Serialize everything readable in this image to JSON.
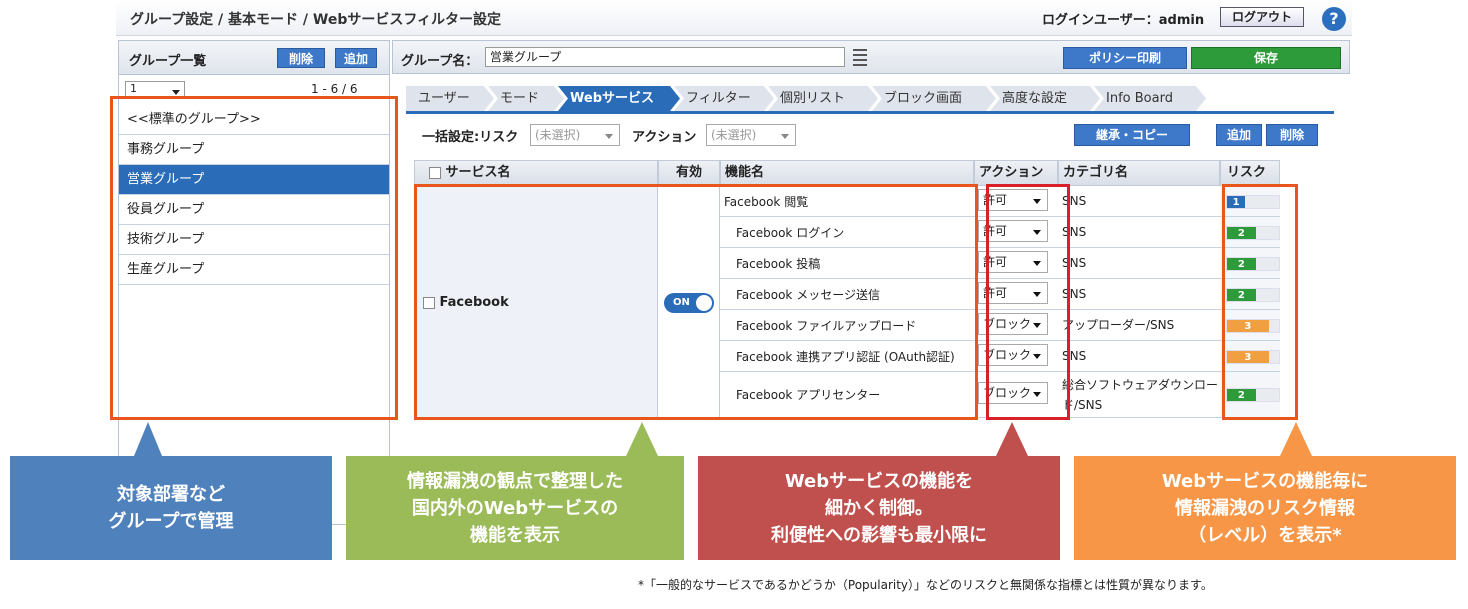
{
  "header": {
    "breadcrumb": "グループ設定 / 基本モード / Webサービスフィルター設定",
    "login_label": "ログインユーザー：admin",
    "logout": "ログアウト",
    "help": "?"
  },
  "group_panel": {
    "title": "グループ一覧",
    "delete": "削除",
    "add": "追加",
    "page": "1",
    "count": "1 - 6 / 6",
    "items": [
      "<<標準のグループ>>",
      "事務グループ",
      "営業グループ",
      "役員グループ",
      "技術グループ",
      "生産グループ"
    ],
    "selected": "営業グループ"
  },
  "main": {
    "group_name_label": "グループ名：",
    "group_name_value": "営業グループ",
    "print_button": "ポリシー印刷",
    "save_button": "保存",
    "tabs": [
      "ユーザー",
      "モード",
      "Webサービス",
      "フィルター",
      "個別リスト",
      "ブロック画面",
      "高度な設定",
      "Info Board"
    ],
    "active_tab": "Webサービス",
    "bulk_label": "一括設定:リスク",
    "bulk_risk_placeholder": "(未選択)",
    "action_label": "アクション",
    "action_placeholder": "(未選択)",
    "inherit_button": "継承・コピー",
    "add_button": "追加",
    "delete_button": "削除",
    "columns": {
      "service": "サービス名",
      "enabled": "有効",
      "function": "機能名",
      "action": "アクション",
      "category": "カテゴリ名",
      "risk": "リスク"
    },
    "service_name": "Facebook",
    "toggle": "ON",
    "rows": [
      {
        "function": "Facebook 閲覧",
        "action": "許可",
        "category": "SNS",
        "risk": "1"
      },
      {
        "function": "Facebook ログイン",
        "action": "許可",
        "category": "SNS",
        "risk": "2"
      },
      {
        "function": "Facebook 投稿",
        "action": "許可",
        "category": "SNS",
        "risk": "2"
      },
      {
        "function": "Facebook メッセージ送信",
        "action": "許可",
        "category": "SNS",
        "risk": "2"
      },
      {
        "function": "Facebook ファイルアップロード",
        "action": "ブロック",
        "category": "アップローダー/SNS",
        "risk": "3"
      },
      {
        "function": "Facebook 連携アプリ認証 (OAuth認証)",
        "action": "ブロック",
        "category": "SNS",
        "risk": "3"
      },
      {
        "function": "Facebook アプリセンター",
        "action": "ブロック",
        "category": "総合ソフトウェアダウンロード/SNS",
        "risk": "2"
      }
    ]
  },
  "callouts": {
    "blue": [
      "対象部署など",
      "グループで管理"
    ],
    "green": [
      "情報漏洩の観点で整理した",
      "国内外のWebサービスの",
      "機能を表示"
    ],
    "red": [
      "Webサービスの機能を",
      "細かく制御。",
      "利便性への影響も最小限に"
    ],
    "orange": [
      "Webサービスの機能毎に",
      "情報漏洩のリスク情報",
      "（レベル）を表示*"
    ]
  },
  "footnote": "*「一般的なサービスであるかどうか（Popularity）」などのリスクと無関係な指標とは性質が異なります。",
  "colors": {
    "blue": "#4f81bd",
    "green": "#9bbb59",
    "red": "#c0504d",
    "orange": "#f79646",
    "frame": "#e8561c",
    "risk1": "#2b6cb8",
    "risk2": "#2e9b3a",
    "risk3": "#f0a040"
  }
}
